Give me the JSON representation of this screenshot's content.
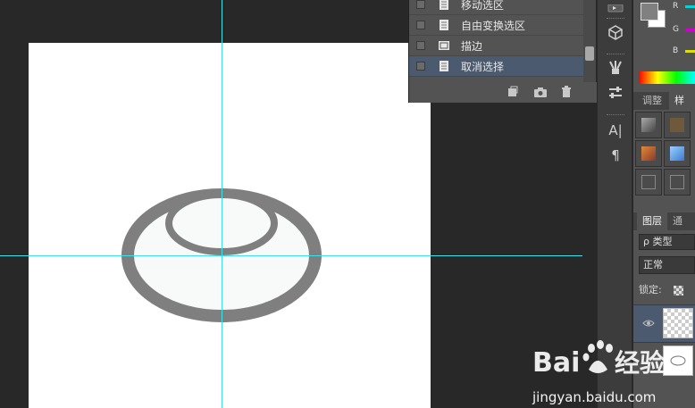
{
  "history": {
    "items": [
      {
        "label": "移动选区",
        "active": false
      },
      {
        "label": "自由变换选区",
        "active": false
      },
      {
        "label": "描边",
        "active": false
      },
      {
        "label": "取消选择",
        "active": true
      }
    ],
    "footer_icons": [
      "new-document-from-state-icon",
      "camera-icon",
      "trash-icon"
    ]
  },
  "toolstrip": {
    "icons": [
      "history-icon",
      "3d-cube-icon",
      "brush-tools-icon",
      "adjust-sliders-icon",
      "character-icon",
      "paragraph-icon"
    ],
    "character_glyph": "A|",
    "paragraph_glyph": "¶"
  },
  "color_panel": {
    "channels": [
      "R",
      "G",
      "B"
    ],
    "foreground": "#808080",
    "background": "#ffffff"
  },
  "adjust_panel": {
    "tabs": [
      "调整",
      "样式"
    ],
    "active_tab": "样式"
  },
  "layers_panel": {
    "tabs": [
      "图层",
      "通道"
    ],
    "filter_label": "ρ 类型",
    "blend_mode": "正常",
    "lock_label": "锁定:"
  },
  "watermark": {
    "logo_text": "Bai du 经验",
    "url": "jingyan.baidu.com"
  },
  "colors": {
    "canvas_bg": "#282828",
    "document": "#ffffff",
    "guide": "#3fe0ea",
    "ring": "#7f7f7f",
    "panel": "#535353",
    "selection": "#4b5a6e"
  }
}
